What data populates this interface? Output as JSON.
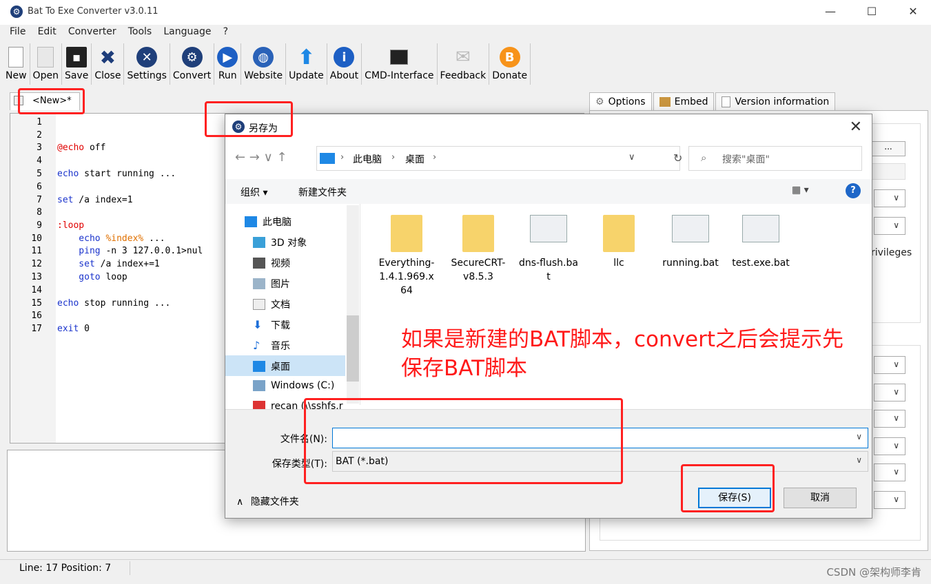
{
  "app": {
    "title": "Bat To Exe Converter v3.0.11",
    "window_controls": {
      "minimize": "—",
      "maximize": "☐",
      "close": "✕"
    }
  },
  "menu": [
    "File",
    "Edit",
    "Converter",
    "Tools",
    "Language",
    "?"
  ],
  "toolbar": [
    {
      "label": "New",
      "icon": "new-document-icon"
    },
    {
      "label": "Open",
      "icon": "open-folder-icon"
    },
    {
      "label": "Save",
      "icon": "floppy-disk-icon"
    },
    {
      "label": "Close",
      "icon": "close-x-icon"
    },
    {
      "label": "Settings",
      "icon": "wrench-icon"
    },
    {
      "label": "Convert",
      "icon": "gear-icon"
    },
    {
      "label": "Run",
      "icon": "play-icon"
    },
    {
      "label": "Website",
      "icon": "globe-icon"
    },
    {
      "label": "Update",
      "icon": "up-arrow-icon"
    },
    {
      "label": "About",
      "icon": "info-icon"
    },
    {
      "label": "CMD-Interface",
      "icon": "console-icon"
    },
    {
      "label": "Feedback",
      "icon": "envelope-icon"
    },
    {
      "label": "Donate",
      "icon": "bitcoin-icon"
    }
  ],
  "editor": {
    "tab_label": "<New>*",
    "lines": [
      "1",
      "2",
      "3",
      "4",
      "5",
      "6",
      "7",
      "8",
      "9",
      "10",
      "11",
      "12",
      "13",
      "14",
      "15",
      "16",
      "17"
    ],
    "code": {
      "l3_a": "@echo",
      "l3_b": " off",
      "l5_a": "echo",
      "l5_b": " start running ...",
      "l7_a": "set",
      "l7_b": " /a index=1",
      "l9": ":loop",
      "l10_a": "    echo ",
      "l10_b": "%index%",
      "l10_c": " ...",
      "l11_a": "    ping",
      "l11_b": " -n 3 127.0.0.1>nul",
      "l12_a": "    set",
      "l12_b": " /a index+=1",
      "l13_a": "    goto",
      "l13_b": " loop",
      "l15_a": "echo",
      "l15_b": " stop running ...",
      "l17_a": "exit",
      "l17_b": " 0"
    }
  },
  "status": {
    "text": "Line: 17  Position: 7"
  },
  "watermark": "CSDN @架构师李肯",
  "right_panel": {
    "tabs": [
      {
        "label": "Options",
        "icon": "gear-icon"
      },
      {
        "label": "Embed",
        "icon": "package-icon"
      },
      {
        "label": "Version information",
        "icon": "document-icon"
      }
    ],
    "browse_label": "...",
    "privileges_text": "rivileges",
    "combo_arrow": "∨"
  },
  "dialog": {
    "title": "另存为",
    "close": "✕",
    "nav_arrows": "←   →   ∨   ↑",
    "address": {
      "seg1": "此电脑",
      "seg2": "桌面",
      "sep": "›",
      "dropdown": "∨"
    },
    "refresh": "↻",
    "search_placeholder": "搜索\"桌面\"",
    "organize": "组织 ▾",
    "new_folder": "新建文件夹",
    "view": "▦ ▾",
    "help": "?",
    "nav_items": [
      {
        "label": "此电脑",
        "icon": "computer-icon"
      },
      {
        "label": "3D 对象",
        "icon": "3d-object-icon"
      },
      {
        "label": "视频",
        "icon": "video-icon"
      },
      {
        "label": "图片",
        "icon": "picture-icon"
      },
      {
        "label": "文档",
        "icon": "document-icon"
      },
      {
        "label": "下载",
        "icon": "download-icon"
      },
      {
        "label": "音乐",
        "icon": "music-icon"
      },
      {
        "label": "桌面",
        "icon": "desktop-icon"
      },
      {
        "label": "Windows (C:)",
        "icon": "drive-icon"
      },
      {
        "label": "recan (\\\\sshfs.r",
        "icon": "network-drive-icon"
      }
    ],
    "files": [
      {
        "name": "Everything-1.4.1.969.x64",
        "kind": "folder"
      },
      {
        "name": "SecureCRT-v8.5.3",
        "kind": "folder"
      },
      {
        "name": "dns-flush.bat",
        "kind": "bat"
      },
      {
        "name": "llc",
        "kind": "folder-shortcut"
      },
      {
        "name": "running.bat",
        "kind": "bat"
      },
      {
        "name": "test.exe.bat",
        "kind": "bat"
      }
    ],
    "annotation": "如果是新建的BAT脚本，convert之后会提示先保存BAT脚本",
    "filename_label": "文件名(N):",
    "filename_value": "",
    "filetype_label": "保存类型(T):",
    "filetype_value": "BAT (*.bat)",
    "save": "保存(S)",
    "cancel": "取消",
    "hide_folders": "隐藏文件夹",
    "hide_chevron": "∧"
  }
}
